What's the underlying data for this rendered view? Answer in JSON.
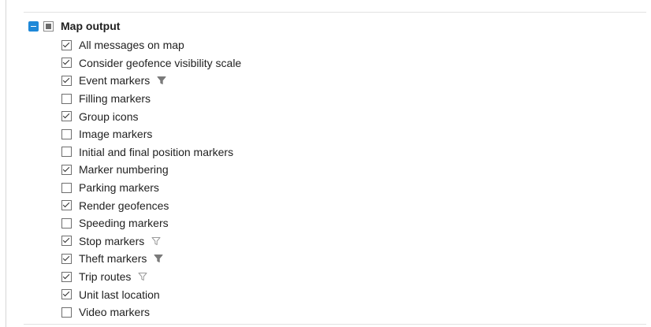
{
  "group": {
    "title": "Map output",
    "collapse_icon": "collapse-minus-icon",
    "state": "partial"
  },
  "colors": {
    "accent": "#1e88d8",
    "filter_solid": "#7a7a7a",
    "filter_outline": "#9a9a9a"
  },
  "options": [
    {
      "label": "All messages on map",
      "checked": true,
      "filter": "none"
    },
    {
      "label": "Consider geofence visibility scale",
      "checked": true,
      "filter": "none"
    },
    {
      "label": "Event markers",
      "checked": true,
      "filter": "solid"
    },
    {
      "label": "Filling markers",
      "checked": false,
      "filter": "none"
    },
    {
      "label": "Group icons",
      "checked": true,
      "filter": "none"
    },
    {
      "label": "Image markers",
      "checked": false,
      "filter": "none"
    },
    {
      "label": "Initial and final position markers",
      "checked": false,
      "filter": "none"
    },
    {
      "label": "Marker numbering",
      "checked": true,
      "filter": "none"
    },
    {
      "label": "Parking markers",
      "checked": false,
      "filter": "none"
    },
    {
      "label": "Render geofences",
      "checked": true,
      "filter": "none"
    },
    {
      "label": "Speeding markers",
      "checked": false,
      "filter": "none"
    },
    {
      "label": "Stop markers",
      "checked": true,
      "filter": "outline"
    },
    {
      "label": "Theft markers",
      "checked": true,
      "filter": "solid"
    },
    {
      "label": "Trip routes",
      "checked": true,
      "filter": "outline"
    },
    {
      "label": "Unit last location",
      "checked": true,
      "filter": "none"
    },
    {
      "label": "Video markers",
      "checked": false,
      "filter": "none"
    }
  ]
}
